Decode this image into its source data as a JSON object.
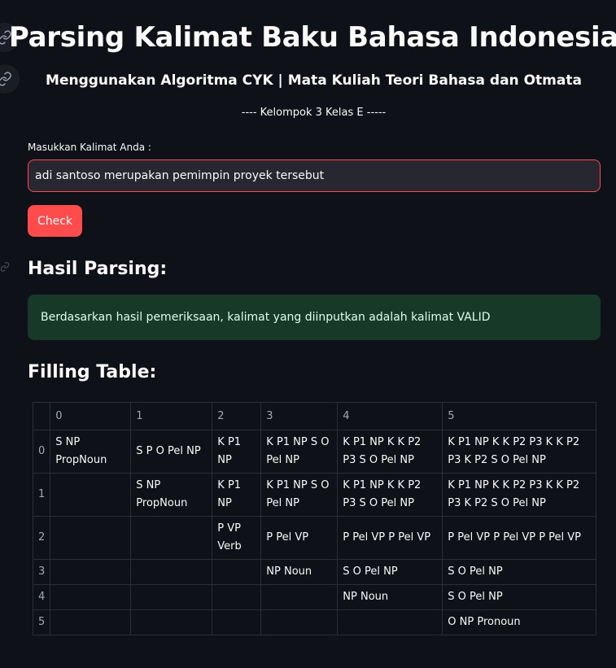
{
  "header": {
    "title": "Parsing Kalimat Baku Bahasa Indonesia",
    "subtitle": "Menggunakan Algoritma CYK | Mata Kuliah Teori Bahasa dan Otmata",
    "group": "---- Kelompok 3 Kelas E -----"
  },
  "form": {
    "label": "Masukkan Kalimat Anda :",
    "input_value": "adi santoso merupakan pemimpin proyek tersebut",
    "button_label": "Check"
  },
  "result": {
    "heading": "Hasil Parsing:",
    "message": "Berdasarkan hasil pemeriksaan, kalimat yang diinputkan adalah kalimat VALID"
  },
  "table": {
    "heading": "Filling Table:",
    "columns": [
      "0",
      "1",
      "2",
      "3",
      "4",
      "5"
    ],
    "rows": [
      {
        "index": "0",
        "cells": [
          "S NP PropNoun",
          "S P O Pel NP",
          "K P1 NP",
          "K P1 NP S O Pel NP",
          "K P1 NP K K P2 P3 S O Pel NP",
          "K P1 NP K K P2 P3 K K P2 P3 K P2 S O Pel NP"
        ]
      },
      {
        "index": "1",
        "cells": [
          "",
          "S NP PropNoun",
          "K P1 NP",
          "K P1 NP S O Pel NP",
          "K P1 NP K K P2 P3 S O Pel NP",
          "K P1 NP K K P2 P3 K K P2 P3 K P2 S O Pel NP"
        ]
      },
      {
        "index": "2",
        "cells": [
          "",
          "",
          "P VP Verb",
          "P Pel VP",
          "P Pel VP P Pel VP",
          "P Pel VP P Pel VP P Pel VP"
        ]
      },
      {
        "index": "3",
        "cells": [
          "",
          "",
          "",
          "NP Noun",
          "S O Pel NP",
          "S O Pel NP"
        ]
      },
      {
        "index": "4",
        "cells": [
          "",
          "",
          "",
          "",
          "NP Noun",
          "S O Pel NP"
        ]
      },
      {
        "index": "5",
        "cells": [
          "",
          "",
          "",
          "",
          "",
          "O NP Pronoun"
        ]
      }
    ]
  },
  "icons": {
    "anchor_1": "link-icon",
    "anchor_2": "link-icon"
  },
  "colors": {
    "background": "#0e1117",
    "accent": "#ff4b4b",
    "success_bg": "#173928",
    "input_bg": "#262730"
  }
}
